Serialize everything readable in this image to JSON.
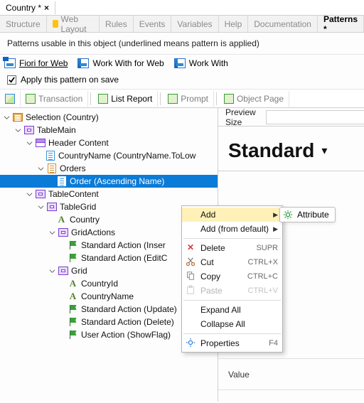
{
  "doc_tab": {
    "title": "Country *"
  },
  "sub_tabs": {
    "t0": "Structure",
    "t1": "Web Layout",
    "t2": "Rules",
    "t3": "Events",
    "t4": "Variables",
    "t5": "Help",
    "t6": "Documentation",
    "t7": "Patterns *"
  },
  "hint": "Patterns usable in this object (underlined means pattern is applied)",
  "patterns": {
    "p0": "Fiori for Web",
    "p1": "Work With for Web",
    "p2": "Work With"
  },
  "apply_label": "Apply this pattern on save",
  "toolbar": {
    "transaction": "Transaction",
    "list_report": "List Report",
    "prompt": "Prompt",
    "object_page": "Object Page"
  },
  "tree": {
    "n0": "Selection (Country)",
    "n1": "TableMain",
    "n2": "Header Content",
    "n3": "CountryName (CountryName.ToLow",
    "n4": "Orders",
    "n5": "Order (Ascending Name)",
    "n6": "TableContent",
    "n7": "TableGrid",
    "n8": "Country",
    "n9": "GridActions",
    "n10": "Standard Action (Inser",
    "n11": "Standard Action (EditC",
    "n12": "Grid",
    "n13": "CountryId",
    "n14": "CountryName",
    "n15": "Standard Action (Update)",
    "n16": "Standard Action (Delete)",
    "n17": "User Action (ShowFlag)"
  },
  "right": {
    "preview_size": "Preview Size",
    "standard": "Standard",
    "value": "Value"
  },
  "attr_pill": "Attribute",
  "ctx": {
    "add": "Add",
    "add_default": "Add (from default)",
    "delete": "Delete",
    "delete_k": "SUPR",
    "cut": "Cut",
    "cut_k": "CTRL+X",
    "copy": "Copy",
    "copy_k": "CTRL+C",
    "paste": "Paste",
    "paste_k": "CTRL+V",
    "expand": "Expand All",
    "collapse": "Collapse All",
    "props": "Properties",
    "props_k": "F4"
  }
}
